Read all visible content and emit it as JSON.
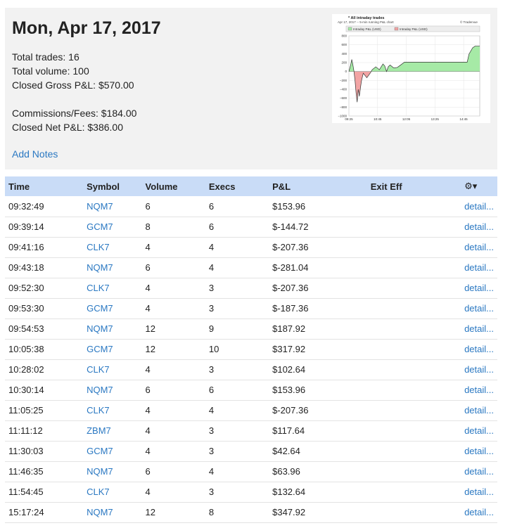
{
  "summary": {
    "date": "Mon, Apr 17, 2017",
    "total_trades": "Total trades: 16",
    "total_volume": "Total volume: 100",
    "closed_gross": "Closed Gross P&L: $570.00",
    "commissions": "Commissions/Fees: $184.00",
    "closed_net": "Closed Net P&L: $386.00",
    "add_notes": "Add Notes"
  },
  "chart_data": {
    "type": "area",
    "title": "* All intraday trades",
    "subtitle": "Apr 17, 2017 -- 5-min running P&L chart",
    "watermark": "© Tradervue",
    "legend": [
      "Intraday P&L (USD)",
      "Intraday P&L (USD)"
    ],
    "positive_color": "#a6eaa6",
    "negative_color": "#f2a4a4",
    "ylim": [
      -1000,
      800
    ],
    "yticks": [
      "800",
      "600",
      "400",
      "200",
      "0",
      "−200",
      "−400",
      "−600",
      "−800",
      "−1000"
    ],
    "xticks": [
      "09:25",
      "10:45",
      "12:05",
      "13:25",
      "14:45"
    ],
    "x": [
      "09:25",
      "09:30",
      "09:33",
      "09:36",
      "09:39",
      "09:42",
      "09:45",
      "09:48",
      "09:51",
      "09:54",
      "09:57",
      "10:00",
      "10:05",
      "10:15",
      "10:25",
      "10:30",
      "10:40",
      "10:50",
      "11:00",
      "11:05",
      "11:10",
      "11:15",
      "11:20",
      "11:30",
      "11:40",
      "11:50",
      "12:00",
      "13:00",
      "14:00",
      "14:55",
      "15:00",
      "15:10",
      "15:17",
      "15:30"
    ],
    "y": [
      0,
      150,
      270,
      154,
      10,
      -200,
      -480,
      -690,
      -400,
      -560,
      -380,
      -210,
      -40,
      -140,
      -30,
      40,
      105,
      40,
      170,
      125,
      0,
      110,
      145,
      80,
      90,
      150,
      210,
      210,
      210,
      210,
      390,
      530,
      570,
      570
    ]
  },
  "table": {
    "headers": [
      "Time",
      "Symbol",
      "Volume",
      "Execs",
      "P&L",
      "Exit Eff"
    ],
    "gear": "⚙▾",
    "detail_label": "detail...",
    "rows": [
      {
        "time": "09:32:49",
        "symbol": "NQM7",
        "volume": "6",
        "execs": "6",
        "pl": "$153.96"
      },
      {
        "time": "09:39:14",
        "symbol": "GCM7",
        "volume": "8",
        "execs": "6",
        "pl": "$-144.72"
      },
      {
        "time": "09:41:16",
        "symbol": "CLK7",
        "volume": "4",
        "execs": "4",
        "pl": "$-207.36"
      },
      {
        "time": "09:43:18",
        "symbol": "NQM7",
        "volume": "6",
        "execs": "4",
        "pl": "$-281.04"
      },
      {
        "time": "09:52:30",
        "symbol": "CLK7",
        "volume": "4",
        "execs": "3",
        "pl": "$-207.36"
      },
      {
        "time": "09:53:30",
        "symbol": "GCM7",
        "volume": "4",
        "execs": "3",
        "pl": "$-187.36"
      },
      {
        "time": "09:54:53",
        "symbol": "NQM7",
        "volume": "12",
        "execs": "9",
        "pl": "$187.92"
      },
      {
        "time": "10:05:38",
        "symbol": "GCM7",
        "volume": "12",
        "execs": "10",
        "pl": "$317.92"
      },
      {
        "time": "10:28:02",
        "symbol": "CLK7",
        "volume": "4",
        "execs": "3",
        "pl": "$102.64"
      },
      {
        "time": "10:30:14",
        "symbol": "NQM7",
        "volume": "6",
        "execs": "6",
        "pl": "$153.96"
      },
      {
        "time": "11:05:25",
        "symbol": "CLK7",
        "volume": "4",
        "execs": "4",
        "pl": "$-207.36"
      },
      {
        "time": "11:11:12",
        "symbol": "ZBM7",
        "volume": "4",
        "execs": "3",
        "pl": "$117.64"
      },
      {
        "time": "11:30:03",
        "symbol": "GCM7",
        "volume": "4",
        "execs": "3",
        "pl": "$42.64"
      },
      {
        "time": "11:46:35",
        "symbol": "NQM7",
        "volume": "6",
        "execs": "4",
        "pl": "$63.96"
      },
      {
        "time": "11:54:45",
        "symbol": "CLK7",
        "volume": "4",
        "execs": "3",
        "pl": "$132.64"
      },
      {
        "time": "15:17:24",
        "symbol": "NQM7",
        "volume": "12",
        "execs": "8",
        "pl": "$347.92"
      }
    ]
  }
}
